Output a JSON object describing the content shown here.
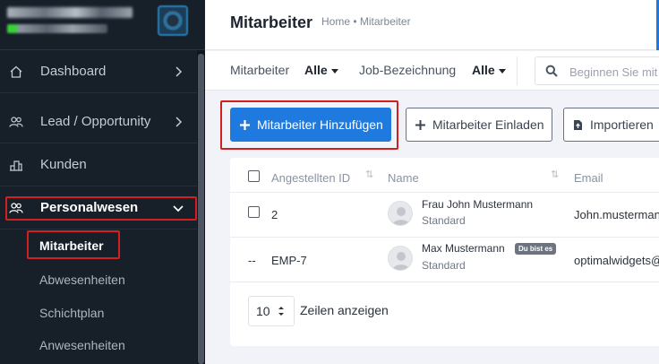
{
  "sidebar": {
    "items": [
      {
        "label": "Dashboard"
      },
      {
        "label": "Lead / Opportunity"
      },
      {
        "label": "Kunden"
      },
      {
        "label": "Personalwesen"
      }
    ],
    "subitems": [
      {
        "label": "Mitarbeiter"
      },
      {
        "label": "Abwesenheiten"
      },
      {
        "label": "Schichtplan"
      },
      {
        "label": "Anwesenheiten"
      }
    ]
  },
  "header": {
    "title": "Mitarbeiter",
    "breadcrumb": "Home • Mitarbeiter"
  },
  "filters": {
    "employee_label": "Mitarbeiter",
    "employee_value": "Alle",
    "job_label": "Job-Bezeichnung",
    "job_value": "Alle",
    "search_placeholder": "Beginnen Sie mit der Eingabe"
  },
  "actions": {
    "add_label": "Mitarbeiter Hinzufügen",
    "invite_label": "Mitarbeiter Einladen",
    "import_label": "Importieren"
  },
  "table": {
    "columns": [
      "Angestellten ID",
      "Name",
      "Email"
    ],
    "rows": [
      {
        "id": "2",
        "name": "Frau John Mustermann",
        "role": "Standard",
        "email": "John.mustermann@",
        "marker": ""
      },
      {
        "id": "EMP-7",
        "name": "Max Mustermann",
        "role": "Standard",
        "email": "optimalwidgets@",
        "marker": "--",
        "badge": "Du bist es"
      }
    ],
    "page_size": "10",
    "page_size_label": "Zeilen anzeigen"
  },
  "colors": {
    "accent": "#1f7ae0",
    "highlight": "#d21f1f",
    "sidebar_bg": "#171f29"
  }
}
